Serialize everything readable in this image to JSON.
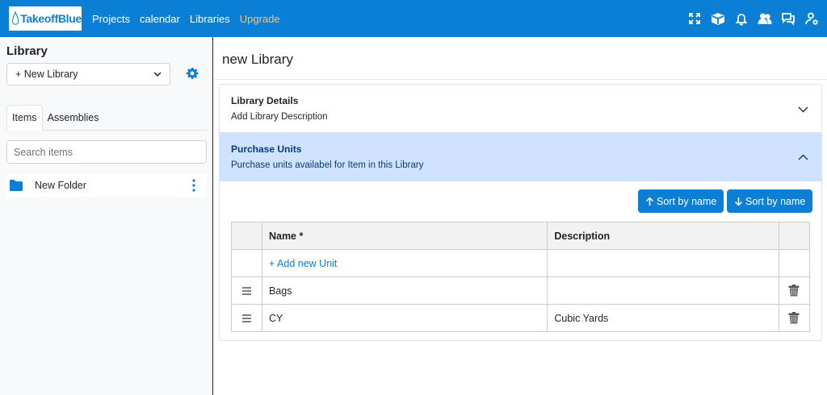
{
  "brand": {
    "logo_text": "TakeoffBlue"
  },
  "nav": {
    "items": [
      {
        "label": "Projects"
      },
      {
        "label": "calendar"
      },
      {
        "label": "Libraries"
      },
      {
        "label": "Upgrade"
      }
    ],
    "icons": [
      "fullscreen-icon",
      "box-icon",
      "bell-icon",
      "users-icon",
      "chat-icon",
      "user-settings-icon"
    ]
  },
  "sidebar": {
    "title": "Library",
    "library_select": {
      "selected": "+ New Library"
    },
    "tabs": [
      {
        "label": "Items",
        "active": true
      },
      {
        "label": "Assemblies",
        "active": false
      }
    ],
    "search": {
      "placeholder": "Search items"
    },
    "folders": [
      {
        "name": "New Folder"
      }
    ]
  },
  "main": {
    "title": "new Library",
    "sections": [
      {
        "heading": "Library Details",
        "subtitle": "Add Library Description",
        "expanded": false
      },
      {
        "heading": "Purchase Units",
        "subtitle": "Purchase units availabel for Item in this Library",
        "expanded": true
      }
    ],
    "sort_buttons": [
      {
        "label": "Sort by name",
        "direction": "up"
      },
      {
        "label": "Sort by name",
        "direction": "down"
      }
    ],
    "table": {
      "headers": {
        "name": "Name *",
        "description": "Description"
      },
      "add_row": "+ Add new Unit",
      "rows": [
        {
          "name": "Bags",
          "description": ""
        },
        {
          "name": "CY",
          "description": "Cubic Yards"
        }
      ]
    }
  },
  "colors": {
    "primary": "#0b7fd6",
    "accent_upgrade": "#f3c08a",
    "expanded_bg": "#cfe2ff"
  }
}
